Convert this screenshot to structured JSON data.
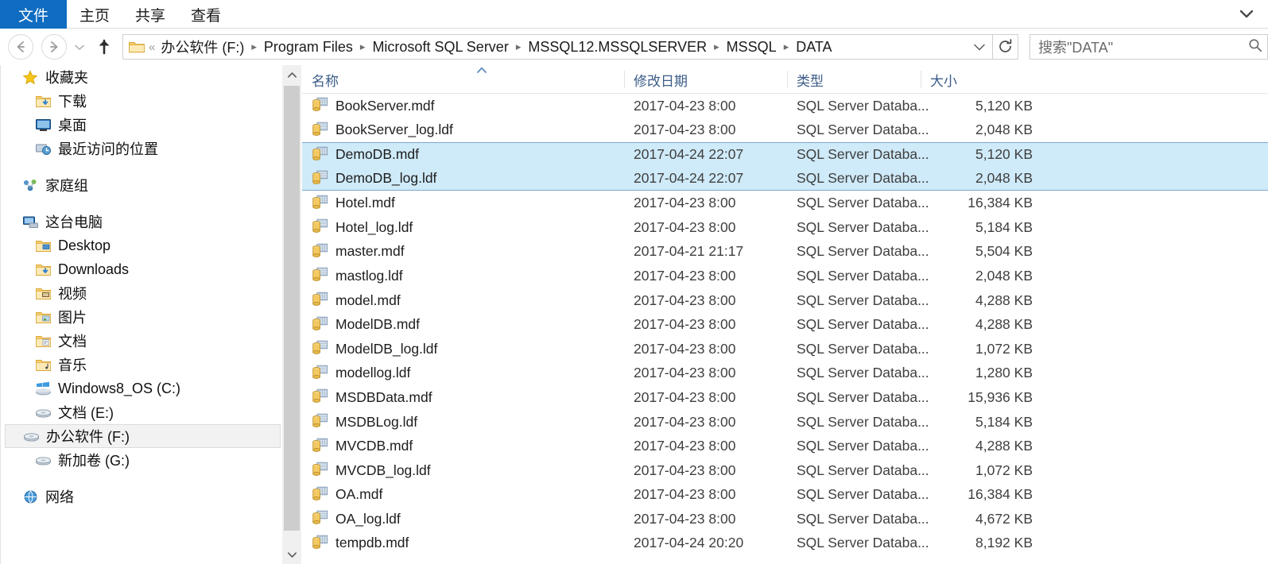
{
  "window": {
    "ribbon_tabs": [
      {
        "label": "文件",
        "active": true
      },
      {
        "label": "主页",
        "active": false
      },
      {
        "label": "共享",
        "active": false
      },
      {
        "label": "查看",
        "active": false
      }
    ],
    "ribbon_expand_icon": "chevron-down-icon",
    "accent_color": "#0f6cc1"
  },
  "toolbar": {
    "back_icon": "arrow-left-icon",
    "forward_icon": "arrow-right-icon",
    "history_icon": "chevron-down-icon",
    "up_icon": "arrow-up-icon",
    "refresh_icon": "refresh-icon",
    "address_dropdown_icon": "chevron-down-icon",
    "overflow_marker": "«",
    "breadcrumbs": [
      "办公软件 (F:)",
      "Program Files",
      "Microsoft SQL Server",
      "MSSQL12.MSSQLSERVER",
      "MSSQL",
      "DATA"
    ],
    "separator": "▶"
  },
  "search": {
    "placeholder": "搜索\"DATA\"",
    "value": "搜索\"DATA\"",
    "icon": "search-icon"
  },
  "sidebar": {
    "groups": [
      {
        "header": {
          "label": "收藏夹",
          "icon": "star-icon",
          "level": 1
        },
        "items": [
          {
            "label": "下载",
            "icon": "folder-download-icon",
            "level": 2
          },
          {
            "label": "桌面",
            "icon": "desktop-icon",
            "level": 2
          },
          {
            "label": "最近访问的位置",
            "icon": "recent-places-icon",
            "level": 2
          }
        ]
      },
      {
        "header": {
          "label": "家庭组",
          "icon": "homegroup-icon",
          "level": 1
        },
        "items": []
      },
      {
        "header": {
          "label": "这台电脑",
          "icon": "this-pc-icon",
          "level": 1
        },
        "items": [
          {
            "label": "Desktop",
            "icon": "folder-desktop-icon",
            "level": 2
          },
          {
            "label": "Downloads",
            "icon": "folder-download-icon",
            "level": 2
          },
          {
            "label": "视频",
            "icon": "folder-video-icon",
            "level": 2
          },
          {
            "label": "图片",
            "icon": "folder-pictures-icon",
            "level": 2
          },
          {
            "label": "文档",
            "icon": "folder-documents-icon",
            "level": 2
          },
          {
            "label": "音乐",
            "icon": "folder-music-icon",
            "level": 2
          },
          {
            "label": "Windows8_OS (C:)",
            "icon": "windows-drive-icon",
            "level": 2
          },
          {
            "label": "文档 (E:)",
            "icon": "drive-icon",
            "level": 2
          },
          {
            "label": "办公软件 (F:)",
            "icon": "drive-icon",
            "level": 2,
            "selected": true
          },
          {
            "label": "新加卷 (G:)",
            "icon": "drive-icon",
            "level": 2
          }
        ]
      },
      {
        "header": {
          "label": "网络",
          "icon": "network-icon",
          "level": 1
        },
        "items": []
      }
    ],
    "scrollbar": {
      "up_icon": "chevron-up-icon",
      "down_icon": "chevron-down-icon"
    }
  },
  "filelist": {
    "columns": [
      {
        "key": "name",
        "label": "名称",
        "sorted": true,
        "sort_icon": "sort-asc-icon"
      },
      {
        "key": "date",
        "label": "修改日期"
      },
      {
        "key": "type",
        "label": "类型"
      },
      {
        "key": "size",
        "label": "大小"
      }
    ],
    "rows": [
      {
        "name": "BookServer.mdf",
        "date": "2017-04-23 8:00",
        "type": "SQL Server Databa...",
        "size": "5,120 KB",
        "icon": "sql-mdf-icon",
        "selected": false
      },
      {
        "name": "BookServer_log.ldf",
        "date": "2017-04-23 8:00",
        "type": "SQL Server Databa...",
        "size": "2,048 KB",
        "icon": "sql-ldf-icon",
        "selected": false
      },
      {
        "name": "DemoDB.mdf",
        "date": "2017-04-24 22:07",
        "type": "SQL Server Databa...",
        "size": "5,120 KB",
        "icon": "sql-mdf-icon",
        "selected": true
      },
      {
        "name": "DemoDB_log.ldf",
        "date": "2017-04-24 22:07",
        "type": "SQL Server Databa...",
        "size": "2,048 KB",
        "icon": "sql-ldf-icon",
        "selected": true
      },
      {
        "name": "Hotel.mdf",
        "date": "2017-04-23 8:00",
        "type": "SQL Server Databa...",
        "size": "16,384 KB",
        "icon": "sql-mdf-icon",
        "selected": false
      },
      {
        "name": "Hotel_log.ldf",
        "date": "2017-04-23 8:00",
        "type": "SQL Server Databa...",
        "size": "5,184 KB",
        "icon": "sql-ldf-icon",
        "selected": false
      },
      {
        "name": "master.mdf",
        "date": "2017-04-21 21:17",
        "type": "SQL Server Databa...",
        "size": "5,504 KB",
        "icon": "sql-mdf-icon",
        "selected": false
      },
      {
        "name": "mastlog.ldf",
        "date": "2017-04-23 8:00",
        "type": "SQL Server Databa...",
        "size": "2,048 KB",
        "icon": "sql-ldf-icon",
        "selected": false
      },
      {
        "name": "model.mdf",
        "date": "2017-04-23 8:00",
        "type": "SQL Server Databa...",
        "size": "4,288 KB",
        "icon": "sql-mdf-icon",
        "selected": false
      },
      {
        "name": "ModelDB.mdf",
        "date": "2017-04-23 8:00",
        "type": "SQL Server Databa...",
        "size": "4,288 KB",
        "icon": "sql-mdf-icon",
        "selected": false
      },
      {
        "name": "ModelDB_log.ldf",
        "date": "2017-04-23 8:00",
        "type": "SQL Server Databa...",
        "size": "1,072 KB",
        "icon": "sql-ldf-icon",
        "selected": false
      },
      {
        "name": "modellog.ldf",
        "date": "2017-04-23 8:00",
        "type": "SQL Server Databa...",
        "size": "1,280 KB",
        "icon": "sql-ldf-icon",
        "selected": false
      },
      {
        "name": "MSDBData.mdf",
        "date": "2017-04-23 8:00",
        "type": "SQL Server Databa...",
        "size": "15,936 KB",
        "icon": "sql-mdf-icon",
        "selected": false
      },
      {
        "name": "MSDBLog.ldf",
        "date": "2017-04-23 8:00",
        "type": "SQL Server Databa...",
        "size": "5,184 KB",
        "icon": "sql-ldf-icon",
        "selected": false
      },
      {
        "name": "MVCDB.mdf",
        "date": "2017-04-23 8:00",
        "type": "SQL Server Databa...",
        "size": "4,288 KB",
        "icon": "sql-mdf-icon",
        "selected": false
      },
      {
        "name": "MVCDB_log.ldf",
        "date": "2017-04-23 8:00",
        "type": "SQL Server Databa...",
        "size": "1,072 KB",
        "icon": "sql-ldf-icon",
        "selected": false
      },
      {
        "name": "OA.mdf",
        "date": "2017-04-23 8:00",
        "type": "SQL Server Databa...",
        "size": "16,384 KB",
        "icon": "sql-mdf-icon",
        "selected": false
      },
      {
        "name": "OA_log.ldf",
        "date": "2017-04-23 8:00",
        "type": "SQL Server Databa...",
        "size": "4,672 KB",
        "icon": "sql-ldf-icon",
        "selected": false
      },
      {
        "name": "tempdb.mdf",
        "date": "2017-04-24 20:20",
        "type": "SQL Server Databa...",
        "size": "8,192 KB",
        "icon": "sql-mdf-icon",
        "selected": false
      }
    ],
    "selection_color": "#cfeaf8",
    "selection_border_color": "#7fa8cd"
  }
}
